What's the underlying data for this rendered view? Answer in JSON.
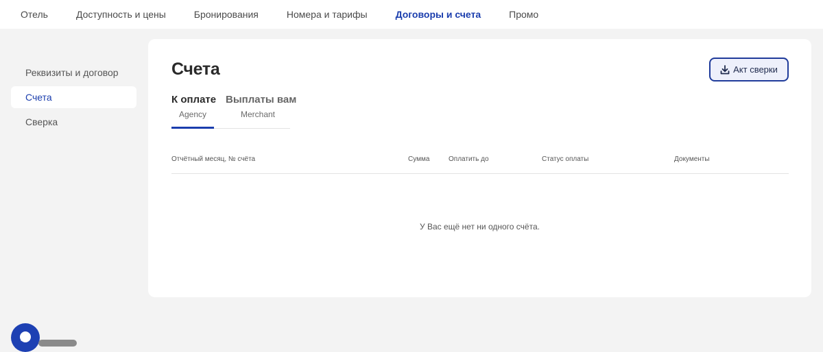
{
  "topnav": {
    "items": [
      {
        "label": "Отель"
      },
      {
        "label": "Доступность и цены"
      },
      {
        "label": "Бронирования"
      },
      {
        "label": "Номера и тарифы"
      },
      {
        "label": "Договоры и счета"
      },
      {
        "label": "Промо"
      }
    ],
    "active_index": 4
  },
  "sidebar": {
    "items": [
      {
        "label": "Реквизиты и договор"
      },
      {
        "label": "Счета"
      },
      {
        "label": "Сверка"
      }
    ],
    "active_index": 1
  },
  "main": {
    "title": "Счета",
    "act_button_label": "Акт сверки",
    "tabs": [
      {
        "label": "К оплате",
        "sub": "Agency"
      },
      {
        "label": "Выплаты вам",
        "sub": "Merchant"
      }
    ],
    "table": {
      "columns": [
        "Отчётный месяц, № счёта",
        "Сумма",
        "Оплатить до",
        "Статус оплаты",
        "Документы"
      ]
    },
    "empty_message": "У Вас ещё нет ни одного счёта."
  },
  "colors": {
    "accent": "#1a3dad",
    "page_background": "#f3f3f3",
    "card_background": "#ffffff"
  },
  "icons": {
    "act_button": "download-icon",
    "chat": "chat-icon"
  }
}
